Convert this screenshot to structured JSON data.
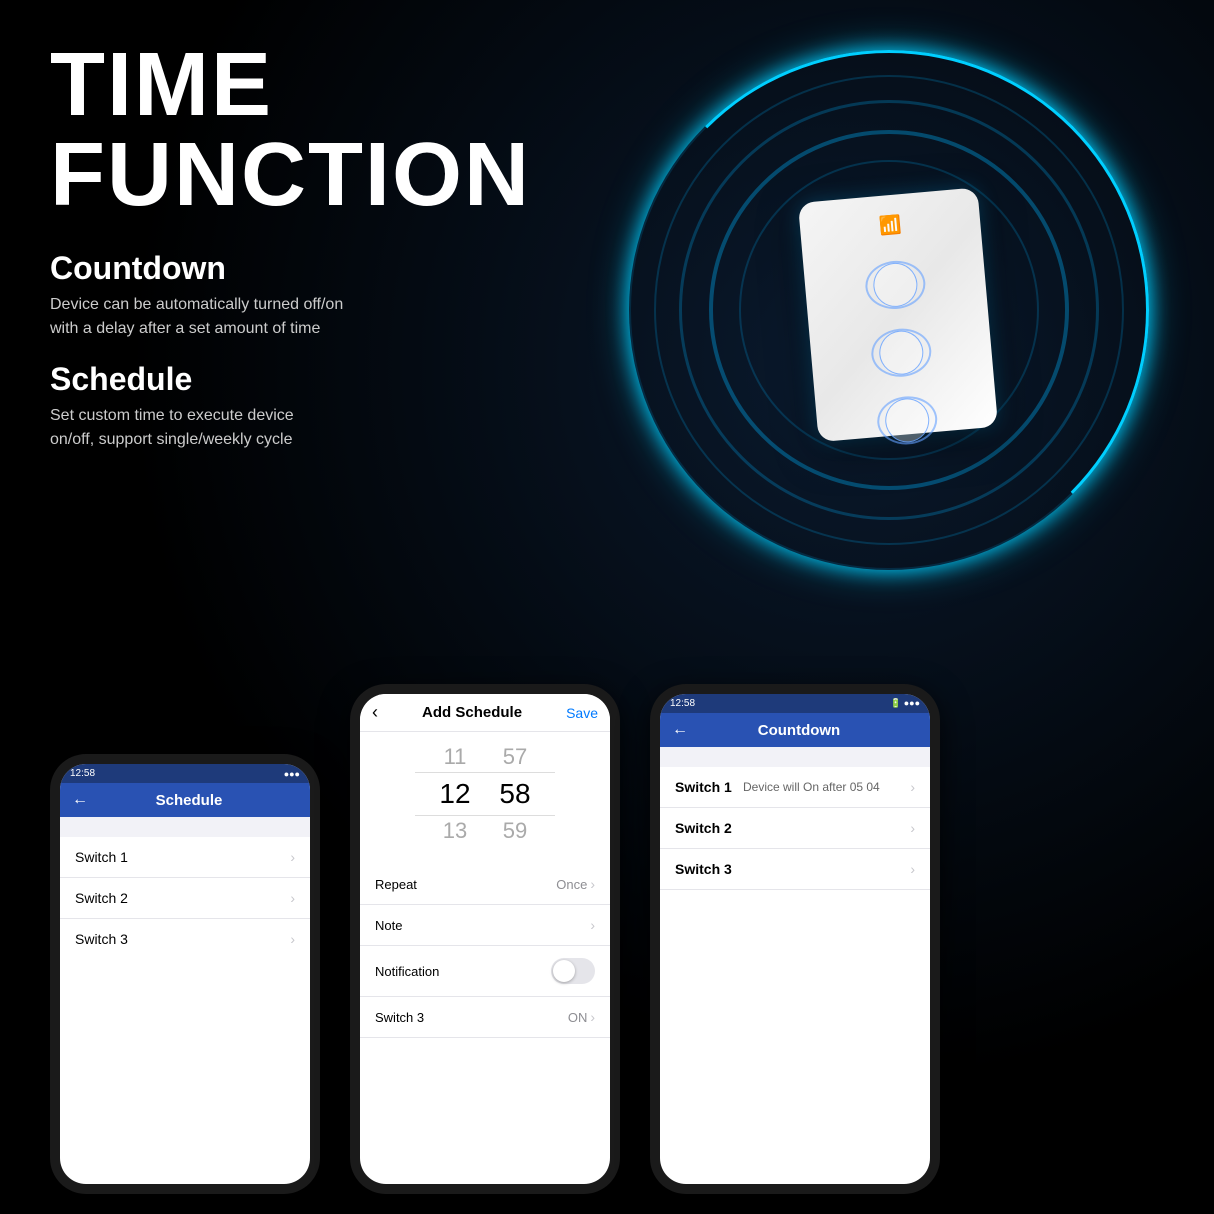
{
  "page": {
    "title": "TIME FUNCTION",
    "background_color": "#000"
  },
  "hero": {
    "title_line1": "TIME",
    "title_line2": "FUNCTION"
  },
  "features": [
    {
      "title": "Countdown",
      "description": "Device can be automatically turned off/on\nwith a delay after a set amount of time"
    },
    {
      "title": "Schedule",
      "description": "Set custom time to execute device\non/off, support single/weekly cycle"
    }
  ],
  "phone1": {
    "status_time": "12:58",
    "header_title": "Schedule",
    "back_label": "←",
    "items": [
      {
        "label": "Switch 1"
      },
      {
        "label": "Switch 2"
      },
      {
        "label": "Switch 3"
      }
    ]
  },
  "phone2": {
    "status_time": "",
    "back_label": "‹",
    "header_title": "Add Schedule",
    "save_label": "Save",
    "time_picker": {
      "top_hour": "11",
      "top_min": "57",
      "mid_hour": "12",
      "mid_min": "58",
      "bot_hour": "13",
      "bot_min": "59"
    },
    "form_rows": [
      {
        "label": "Repeat",
        "value": "Once",
        "type": "chevron"
      },
      {
        "label": "Note",
        "value": "",
        "type": "chevron"
      },
      {
        "label": "Notification",
        "value": "",
        "type": "toggle"
      },
      {
        "label": "Switch 3",
        "value": "ON",
        "type": "chevron"
      }
    ]
  },
  "phone3": {
    "status_time": "12:58",
    "header_title": "Countdown",
    "back_label": "←",
    "items": [
      {
        "label": "Switch 1",
        "desc": "Device will On after 05 04"
      },
      {
        "label": "Switch 2",
        "desc": ""
      },
      {
        "label": "Switch 3",
        "desc": ""
      }
    ]
  }
}
